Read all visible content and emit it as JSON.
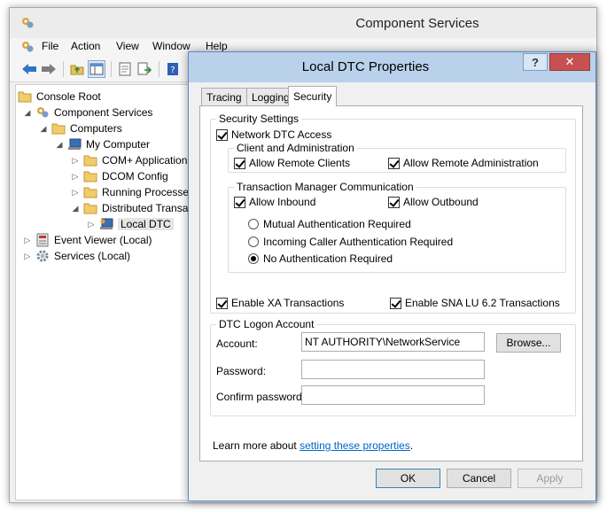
{
  "mmc": {
    "title": "Component Services",
    "menu": [
      "File",
      "Action",
      "View",
      "Window",
      "Help"
    ],
    "tree": [
      {
        "label": "Console Root",
        "expander": "",
        "icon": "folder-icon"
      },
      {
        "label": "Component Services",
        "expander": "◢",
        "icon": "component-services-icon"
      },
      {
        "label": "Computers",
        "expander": "◢",
        "icon": "folder-icon"
      },
      {
        "label": "My Computer",
        "expander": "◢",
        "icon": "computer-icon"
      },
      {
        "label": "COM+ Applications",
        "expander": "▷",
        "icon": "folder-icon"
      },
      {
        "label": "DCOM Config",
        "expander": "▷",
        "icon": "folder-icon"
      },
      {
        "label": "Running Processes",
        "expander": "▷",
        "icon": "folder-icon"
      },
      {
        "label": "Distributed Transaction Coordinator",
        "expander": "◢",
        "icon": "folder-icon"
      },
      {
        "label": "Local DTC",
        "expander": "▷",
        "icon": "dtc-icon"
      },
      {
        "label": "Event Viewer (Local)",
        "expander": "▷",
        "icon": "event-viewer-icon"
      },
      {
        "label": "Services (Local)",
        "expander": "▷",
        "icon": "services-gear-icon"
      }
    ]
  },
  "dialog": {
    "title": "Local DTC Properties",
    "help": "?",
    "close": "✕",
    "tabs": [
      "Tracing",
      "Logging",
      "Security"
    ],
    "security_settings": {
      "label": "Security Settings",
      "network_dtc_access": {
        "label": "Network DTC Access",
        "checked": true
      },
      "client_admin": {
        "label": "Client and Administration",
        "allow_remote_clients": {
          "label": "Allow Remote Clients",
          "checked": true
        },
        "allow_remote_admin": {
          "label": "Allow Remote Administration",
          "checked": true
        }
      },
      "tm_comm": {
        "label": "Transaction Manager Communication",
        "allow_inbound": {
          "label": "Allow Inbound",
          "checked": true
        },
        "allow_outbound": {
          "label": "Allow Outbound",
          "checked": true
        },
        "radios": [
          {
            "label": "Mutual Authentication Required",
            "selected": false
          },
          {
            "label": "Incoming Caller Authentication Required",
            "selected": false
          },
          {
            "label": "No Authentication Required",
            "selected": true
          }
        ]
      },
      "enable_xa": {
        "label": "Enable XA Transactions",
        "checked": true
      },
      "enable_sna": {
        "label": "Enable SNA LU 6.2 Transactions",
        "checked": true
      }
    },
    "logon": {
      "label": "DTC Logon Account",
      "account_label": "Account:",
      "account_value": "NT AUTHORITY\\NetworkService",
      "browse": "Browse...",
      "password_label": "Password:",
      "password_value": "",
      "confirm_label": "Confirm password:",
      "confirm_value": ""
    },
    "learn_more_prefix": "Learn more about ",
    "learn_more_link": "setting these properties",
    "learn_more_suffix": ".",
    "buttons": {
      "ok": "OK",
      "cancel": "Cancel",
      "apply": "Apply"
    }
  },
  "colors": {
    "dialog_titlebar": "#b9d1ea",
    "close_button": "#c75050",
    "link": "#0066cc"
  }
}
